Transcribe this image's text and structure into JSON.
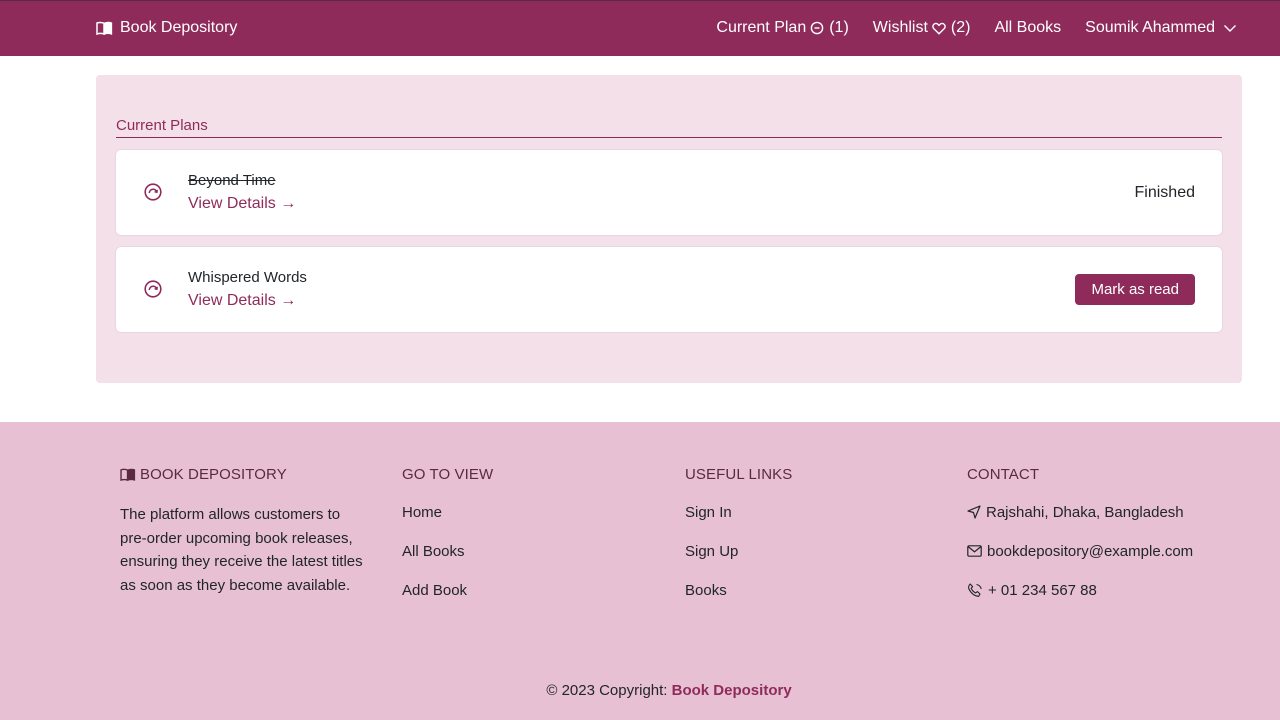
{
  "brand": {
    "name": "Book Depository",
    "icon": "open-book-icon"
  },
  "nav": {
    "current_plan_label": "Current Plan",
    "current_plan_count": "(1)",
    "wishlist_label": "Wishlist",
    "wishlist_count": "(2)",
    "all_books_label": "All Books",
    "user_name": "Soumik Ahammed"
  },
  "plans": {
    "heading": "Current Plans",
    "items": [
      {
        "title": "Beyond Time",
        "link_label": "View Details →",
        "status": "Finished",
        "finished": true
      },
      {
        "title": "Whispered Words",
        "link_label": "View Details →",
        "action_label": "Mark as read",
        "finished": false
      }
    ]
  },
  "footer": {
    "brand_heading": "BOOK DEPOSITORY",
    "description": "The platform allows customers to pre-order upcoming book releases, ensuring they receive the latest titles as soon as they become available.",
    "go_to_view": {
      "heading": "GO TO VIEW",
      "links": [
        "Home",
        "All Books",
        "Add Book"
      ]
    },
    "useful_links": {
      "heading": "USEFUL LINKS",
      "links": [
        "Sign In",
        "Sign Up",
        "Books"
      ]
    },
    "contact": {
      "heading": "CONTACT",
      "address": "Rajshahi, Dhaka, Bangladesh",
      "email": "bookdepository@example.com",
      "phone": "+ 01 234 567 88"
    },
    "copyright_prefix": "© 2023 Copyright:",
    "copyright_name": "Book Depository"
  },
  "colors": {
    "primary": "#8f2b5b",
    "panel_bg": "#f4e0e9",
    "footer_bg": "#e7c1d3"
  }
}
